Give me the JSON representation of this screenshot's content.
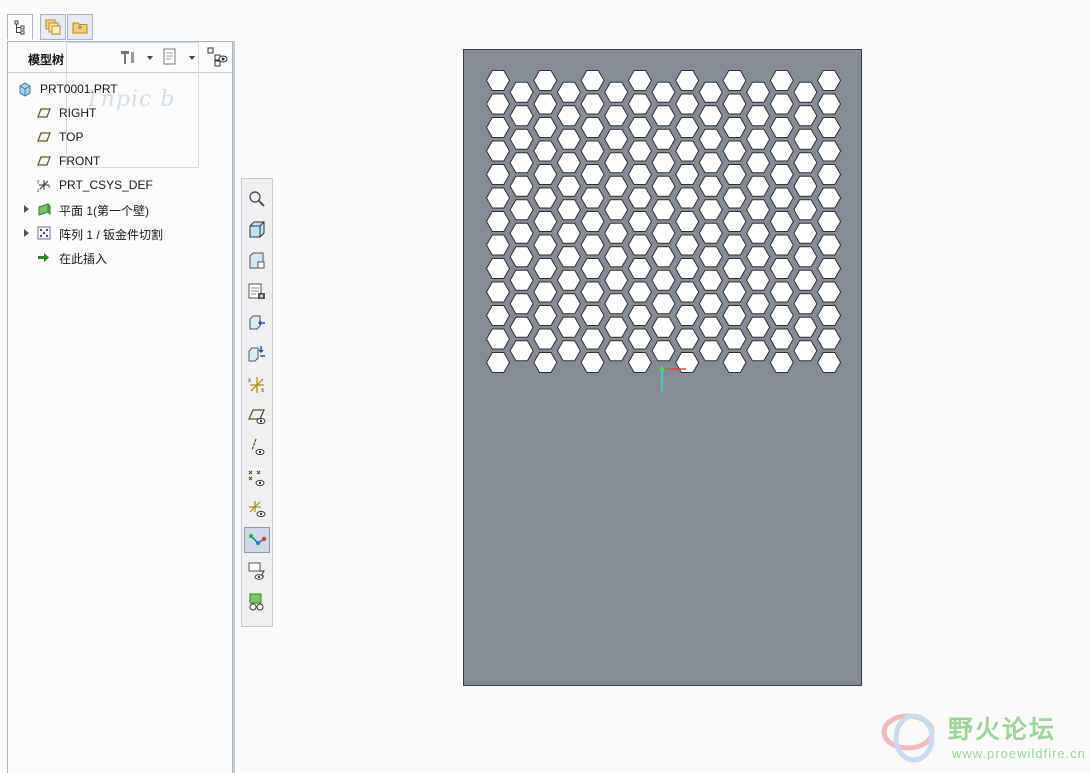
{
  "navigator": {
    "tabs": [
      {
        "name": "model-tree-tab",
        "icon": "model-tree-icon",
        "active": true
      },
      {
        "name": "layers-tab",
        "icon": "layers-icon",
        "active": false
      },
      {
        "name": "folder-browser-tab",
        "icon": "folder-icon",
        "active": false
      }
    ],
    "title": "模型树",
    "watermark": "Tnpic b",
    "tree": [
      {
        "label": "PRT0001.PRT",
        "icon": "part-icon",
        "indent": 0,
        "expandable": false
      },
      {
        "label": "RIGHT",
        "icon": "datum-plane-icon",
        "indent": 1,
        "expandable": false
      },
      {
        "label": "TOP",
        "icon": "datum-plane-icon",
        "indent": 1,
        "expandable": false
      },
      {
        "label": "FRONT",
        "icon": "datum-plane-icon",
        "indent": 1,
        "expandable": false
      },
      {
        "label": "PRT_CSYS_DEF",
        "icon": "coordinate-system-icon",
        "indent": 1,
        "expandable": false
      },
      {
        "label": "平面 1(第一个壁)",
        "icon": "sheetmetal-wall-icon",
        "indent": 1,
        "expandable": true
      },
      {
        "label": "阵列 1 / 钣金件切割",
        "icon": "pattern-icon",
        "indent": 1,
        "expandable": true
      },
      {
        "label": "在此插入",
        "icon": "insert-here-arrow-icon",
        "indent": 1,
        "expandable": false
      }
    ]
  },
  "view_toolbar": [
    {
      "name": "zoom-button",
      "icon": "zoom-icon"
    },
    {
      "name": "saved-view-button",
      "icon": "view-cube-icon"
    },
    {
      "name": "view-manager-button",
      "icon": "view-manager-icon"
    },
    {
      "name": "snapshot-button",
      "icon": "snapshot-icon"
    },
    {
      "name": "reorient-button",
      "icon": "reorient-icon"
    },
    {
      "name": "spin-orient-button",
      "icon": "spin-orient-icon"
    },
    {
      "name": "csys-button",
      "icon": "csys-icon"
    },
    {
      "name": "plane-display-button",
      "icon": "plane-display-icon"
    },
    {
      "name": "axis-display-button",
      "icon": "axis-display-icon"
    },
    {
      "name": "point-display-button",
      "icon": "point-display-icon"
    },
    {
      "name": "csys-display-button",
      "icon": "csys-display-icon"
    },
    {
      "name": "spin-center-button",
      "icon": "spin-center-icon",
      "active": true
    },
    {
      "name": "annotation-display-button",
      "icon": "annotation-display-icon"
    },
    {
      "name": "appearance-button",
      "icon": "appearance-icon"
    }
  ],
  "model": {
    "plate_color": "#858c95",
    "hole_color": "#ffffff",
    "odd_rows": 13,
    "even_rows": 12,
    "odd_row_holes": 8,
    "even_row_holes": 7
  },
  "logo": {
    "name": "野火论坛",
    "url": "www.proewildfire.cn"
  }
}
